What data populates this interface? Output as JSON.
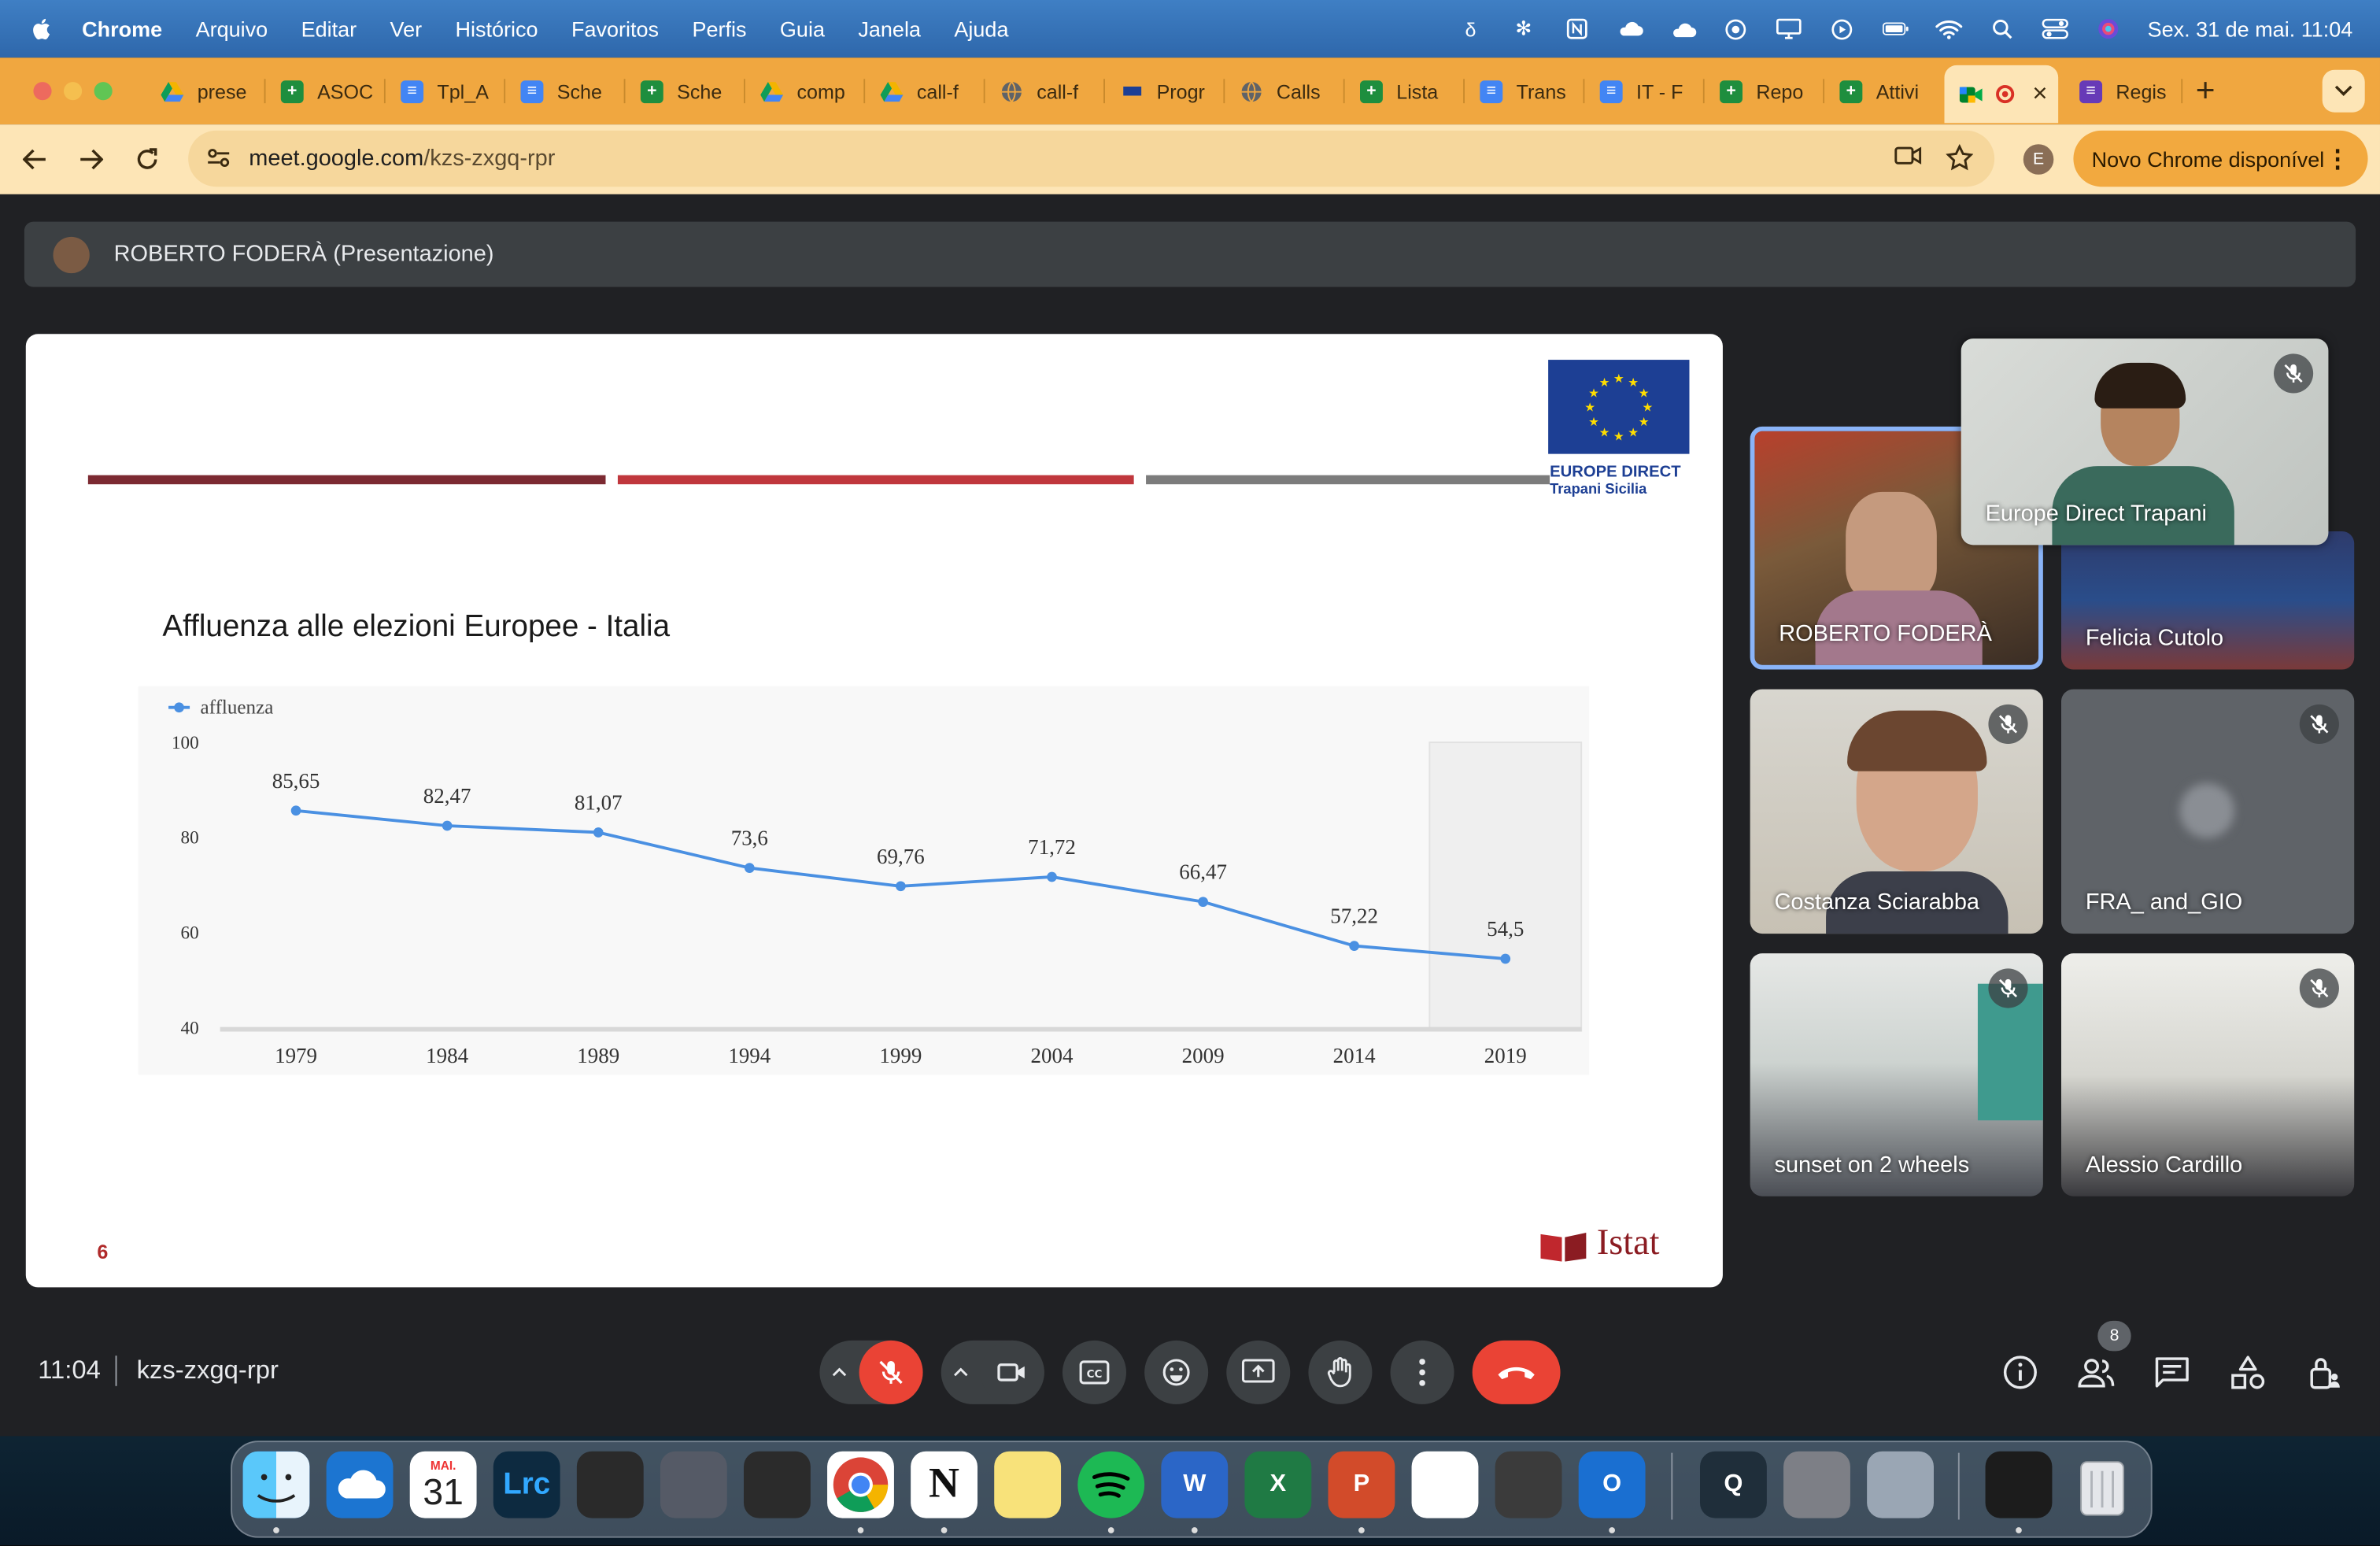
{
  "menubar": {
    "app": "Chrome",
    "items": [
      "Arquivo",
      "Editar",
      "Ver",
      "Histórico",
      "Favoritos",
      "Perfis",
      "Guia",
      "Janela",
      "Ajuda"
    ],
    "datetime": "Sex. 31 de mai.  11:04"
  },
  "tabs": [
    {
      "label": "prese",
      "icon": "drive-icon"
    },
    {
      "label": "ASOC",
      "icon": "sheets-icon"
    },
    {
      "label": "Tpl_A",
      "icon": "docs-icon"
    },
    {
      "label": "Sche",
      "icon": "docs-icon"
    },
    {
      "label": "Sche",
      "icon": "sheets-icon"
    },
    {
      "label": "comp",
      "icon": "drive-icon"
    },
    {
      "label": "call-f",
      "icon": "drive-icon"
    },
    {
      "label": "call-f",
      "icon": "globe-icon"
    },
    {
      "label": "Progr",
      "icon": "eu-flag-icon"
    },
    {
      "label": "Calls",
      "icon": "globe-icon"
    },
    {
      "label": "Lista",
      "icon": "sheets-icon"
    },
    {
      "label": "Trans",
      "icon": "docs-icon"
    },
    {
      "label": "IT - F",
      "icon": "docs-icon"
    },
    {
      "label": "Repo",
      "icon": "sheets-icon"
    },
    {
      "label": "Attivi",
      "icon": "sheets-icon"
    }
  ],
  "active_tab": {
    "icon": "meet-icon",
    "close": "×"
  },
  "last_tab": {
    "label": "Regis",
    "icon": "forms-icon"
  },
  "new_tab_label": "+",
  "address_bar": {
    "host": "meet.google.com",
    "path": "/kzs-zxgq-rpr"
  },
  "profile_initial": "E",
  "update_button": "Novo Chrome disponível",
  "presenter_bar": "ROBERTO FODERÀ (Presentazione)",
  "slide": {
    "eu_text_1": "EUROPE DIRECT",
    "eu_text_2": "Trapani Sicilia",
    "chart_title": "Affluenza alle elezioni Europee - Italia",
    "page_number": "6",
    "istat_label": "Istat",
    "brand_colors": {
      "bar1": "#7c2a32",
      "bar2": "#c0373d",
      "bar3": "#7c7c7c",
      "eu_blue": "#1d3f94"
    }
  },
  "chart_data": {
    "type": "line",
    "title": "Affluenza alle elezioni Europee - Italia",
    "categories": [
      "1979",
      "1984",
      "1989",
      "1994",
      "1999",
      "2004",
      "2009",
      "2014",
      "2019"
    ],
    "series": [
      {
        "name": "affluenza",
        "values": [
          85.65,
          82.47,
          81.07,
          73.6,
          69.76,
          71.72,
          66.47,
          57.22,
          54.5
        ],
        "color": "#4a90e2"
      }
    ],
    "data_labels": [
      "85,65",
      "82,47",
      "81,07",
      "73,6",
      "69,76",
      "71,72",
      "66,47",
      "57,22",
      "54,5"
    ],
    "y_ticks": [
      "100",
      "80",
      "60",
      "40"
    ],
    "ylim": [
      40,
      100
    ],
    "highlighted_category": "2019",
    "legend": "top-left",
    "grid": false
  },
  "participants": [
    {
      "name": "Europe Direct Trapani",
      "muted": true
    },
    {
      "name": "ROBERTO FODERÀ",
      "muted": false,
      "speaking": true
    },
    {
      "name": "Felicia Cutolo",
      "muted": false
    },
    {
      "name": "Costanza Sciarabba",
      "muted": true
    },
    {
      "name": "FRA_ and_GIO",
      "muted": true
    },
    {
      "name": "sunset on 2 wheels",
      "muted": true
    },
    {
      "name": "Alessio Cardillo",
      "muted": true
    }
  ],
  "meeting": {
    "time": "11:04",
    "code": "kzs-zxgq-rpr",
    "participant_count": "8"
  },
  "dock": [
    {
      "name": "finder",
      "color": "#2d8cf0",
      "label": ""
    },
    {
      "name": "onedrive",
      "color": "#1c75d1",
      "label": ""
    },
    {
      "name": "calendar",
      "color": "#ffffff",
      "month": "MAI.",
      "day": "31"
    },
    {
      "name": "lightroom",
      "color": "#0d2a40",
      "label": "Lrc"
    },
    {
      "name": "final-cut",
      "color": "#2a2a2a",
      "label": ""
    },
    {
      "name": "compressor",
      "color": "#555a66",
      "label": ""
    },
    {
      "name": "davinci",
      "color": "#2b2b2b",
      "label": ""
    },
    {
      "name": "chrome",
      "color": "#ffffff",
      "label": ""
    },
    {
      "name": "notion",
      "color": "#ffffff",
      "label": "N"
    },
    {
      "name": "notes",
      "color": "#f8e27a",
      "label": ""
    },
    {
      "name": "spotify",
      "color": "#1db954",
      "label": ""
    },
    {
      "name": "word",
      "color": "#2b66c7",
      "label": "W"
    },
    {
      "name": "excel",
      "color": "#1f7a44",
      "label": "X"
    },
    {
      "name": "powerpoint",
      "color": "#d24b2a",
      "label": "P"
    },
    {
      "name": "capcut",
      "color": "#ffffff",
      "label": ""
    },
    {
      "name": "calculator",
      "color": "#3b3b3b",
      "label": ""
    },
    {
      "name": "outlook",
      "color": "#1a6fd1",
      "label": "O"
    },
    {
      "name": "quicktime",
      "color": "#1f2e3a",
      "label": "Q"
    },
    {
      "name": "settings",
      "color": "#7d7f86",
      "label": ""
    },
    {
      "name": "preview",
      "color": "#9aa6b4",
      "label": ""
    },
    {
      "name": "recent-window",
      "color": "#1c1c1c",
      "label": ""
    },
    {
      "name": "trash",
      "color": "#c9ccd1",
      "label": ""
    }
  ]
}
